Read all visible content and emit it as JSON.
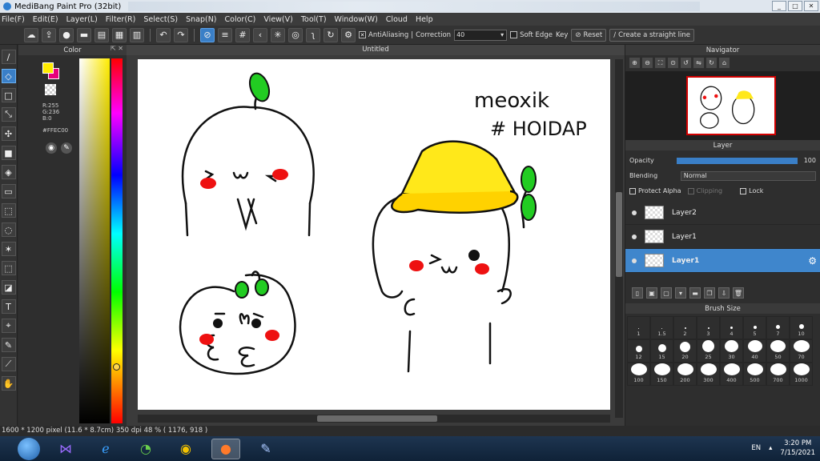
{
  "window": {
    "title": "MediBang Paint Pro (32bit)"
  },
  "menu": [
    "File(F)",
    "Edit(E)",
    "Layer(L)",
    "Filter(R)",
    "Select(S)",
    "Snap(N)",
    "Color(C)",
    "View(V)",
    "Tool(T)",
    "Window(W)",
    "Cloud",
    "Help"
  ],
  "toolbar": {
    "antialiasing_label": "AntiAliasing",
    "correction_label": "Correction",
    "correction_value": "40",
    "soft_edge_label": "Soft Edge",
    "key_label": "Key",
    "reset_label": "Reset",
    "straight_line_label": "Create a straight line"
  },
  "color_panel": {
    "title": "Color",
    "r": "R:255",
    "g": "G:236",
    "b": "B:0",
    "hex": "#FFEC00",
    "foreground_color": "#ffec00",
    "background_color": "#e8007a"
  },
  "document": {
    "tab_title": "Untitled",
    "canvas_text_1": "meoxik",
    "canvas_text_2": "# HOIDAP"
  },
  "navigator": {
    "title": "Navigator"
  },
  "layer_panel": {
    "title": "Layer",
    "opacity_label": "Opacity",
    "opacity_value": "100",
    "blending_label": "Blending",
    "blending_value": "Normal",
    "protect_alpha_label": "Protect Alpha",
    "clipping_label": "Clipping",
    "lock_label": "Lock",
    "layers": [
      {
        "name": "Layer2",
        "selected": false
      },
      {
        "name": "Layer1",
        "selected": false
      },
      {
        "name": "Layer1",
        "selected": true
      }
    ]
  },
  "brush_size": {
    "title": "Brush Size",
    "sizes": [
      "1",
      "1.5",
      "2",
      "3",
      "4",
      "5",
      "7",
      "10",
      "12",
      "15",
      "20",
      "25",
      "30",
      "40",
      "50",
      "70",
      "100",
      "150",
      "200",
      "300",
      "400",
      "500",
      "700",
      "1000"
    ]
  },
  "status": {
    "text": "1600 * 1200 pixel  (11.6 * 8.7cm)  350 dpi  48 %  ( 1176, 918 )"
  },
  "taskbar": {
    "lang": "EN",
    "time": "3:20 PM",
    "date": "7/15/2021"
  }
}
